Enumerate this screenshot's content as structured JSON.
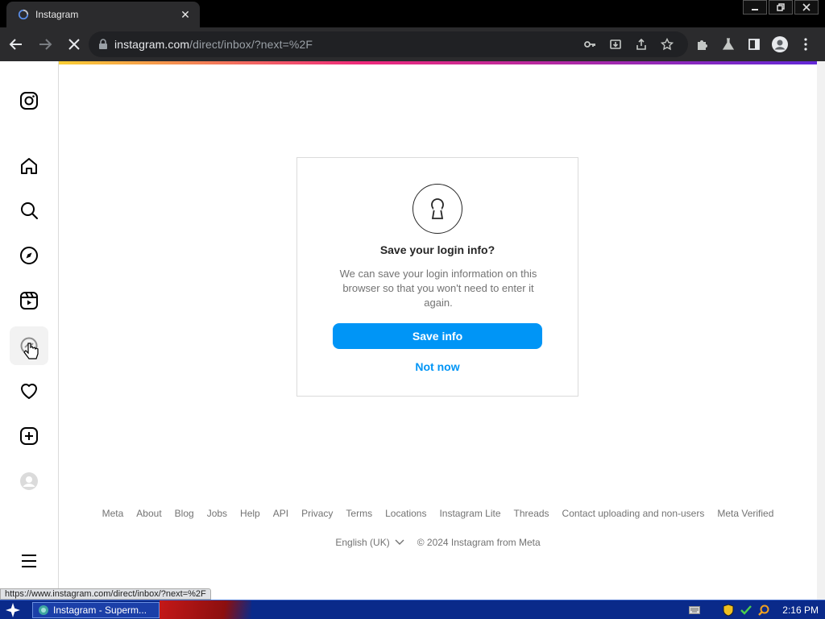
{
  "browser": {
    "tab_title": "Instagram",
    "url_host": "instagram.com",
    "url_path": "/direct/inbox/?next=%2F",
    "status_url": "https://www.instagram.com/direct/inbox/?next=%2F"
  },
  "sidebar": {
    "items": [
      {
        "name": "instagram-logo-icon"
      },
      {
        "name": "home-icon"
      },
      {
        "name": "search-icon"
      },
      {
        "name": "explore-icon"
      },
      {
        "name": "reels-icon"
      },
      {
        "name": "messages-icon"
      },
      {
        "name": "notifications-icon"
      },
      {
        "name": "create-icon"
      },
      {
        "name": "profile-avatar"
      },
      {
        "name": "more-menu-icon"
      }
    ]
  },
  "dialog": {
    "title": "Save your login info?",
    "text": "We can save your login information on this browser so that you won't need to enter it again.",
    "save_label": "Save info",
    "not_now_label": "Not now"
  },
  "footer": {
    "links": [
      "Meta",
      "About",
      "Blog",
      "Jobs",
      "Help",
      "API",
      "Privacy",
      "Terms",
      "Locations",
      "Instagram Lite",
      "Threads",
      "Contact uploading and non-users",
      "Meta Verified"
    ],
    "language": "English (UK)",
    "copyright": "© 2024 Instagram from Meta"
  },
  "taskbar": {
    "task_label": "Instagram - Superm...",
    "clock": "2:16 PM"
  },
  "colors": {
    "accent": "#0095f6",
    "text_primary": "#262626",
    "text_secondary": "#737373"
  }
}
